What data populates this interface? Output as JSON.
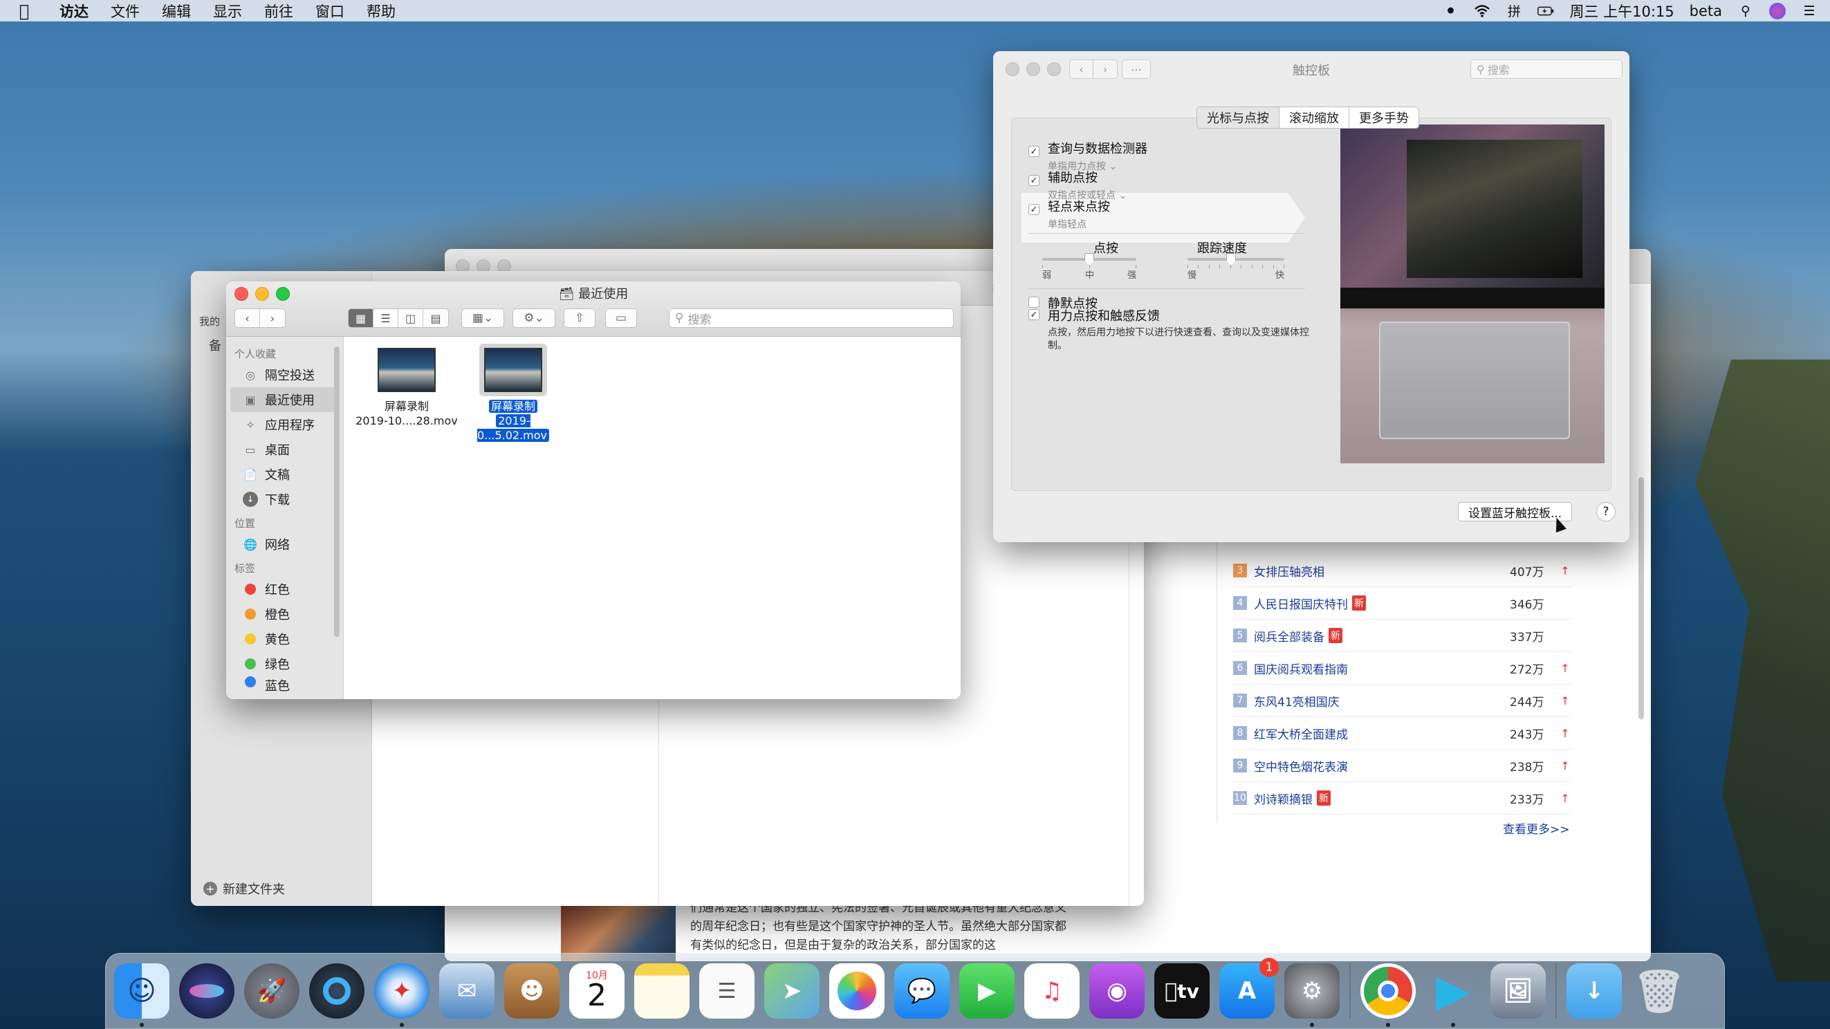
{
  "menubar": {
    "app_name": "访达",
    "items": [
      "文件",
      "编辑",
      "显示",
      "前往",
      "窗口",
      "帮助"
    ],
    "clock": "周三 上午10:15",
    "user": "beta"
  },
  "finder_back": {
    "sidebar_header_stub": "我的",
    "sidebar_item_stub": "备",
    "new_folder": "新建文件夹",
    "search_stub": "搜索"
  },
  "finder": {
    "title": "最近使用",
    "search_placeholder": "搜索",
    "sections": {
      "favorites": "个人收藏",
      "locations": "位置",
      "tags": "标签"
    },
    "favorites": [
      {
        "label": "隔空投送",
        "icon": "airdrop-icon"
      },
      {
        "label": "最近使用",
        "icon": "recents-icon"
      },
      {
        "label": "应用程序",
        "icon": "applications-icon"
      },
      {
        "label": "桌面",
        "icon": "desktop-icon"
      },
      {
        "label": "文稿",
        "icon": "documents-icon"
      },
      {
        "label": "下载",
        "icon": "downloads-icon"
      }
    ],
    "locations": [
      {
        "label": "网络",
        "icon": "network-icon"
      }
    ],
    "tags": [
      {
        "label": "红色",
        "color": "#f0443a"
      },
      {
        "label": "橙色",
        "color": "#f39a2c"
      },
      {
        "label": "黄色",
        "color": "#f5c82f"
      },
      {
        "label": "绿色",
        "color": "#4cbc4a"
      },
      {
        "label": "蓝色",
        "color": "#2c7ef5"
      }
    ],
    "files": [
      {
        "line1": "屏幕录制",
        "line2": "2019-10....28.mov"
      },
      {
        "line1": "屏幕录制",
        "line2": "2019-0...5.02.mov"
      }
    ]
  },
  "trackpad": {
    "title": "触控板",
    "search_placeholder": "搜索",
    "tabs": [
      "光标与点按",
      "滚动缩放",
      "更多手势"
    ],
    "options": [
      {
        "title": "查询与数据检测器",
        "subtitle": "单指用力点按 ⌄",
        "checked": true
      },
      {
        "title": "辅助点按",
        "subtitle": "双指点按或轻点 ⌄",
        "checked": true
      },
      {
        "title": "轻点来点按",
        "subtitle": "单指轻点",
        "checked": true
      }
    ],
    "click_slider": {
      "label": "点按",
      "min": "弱",
      "mid": "中",
      "max": "强",
      "value": 0.5
    },
    "tracking_slider": {
      "label": "跟踪速度",
      "min": "慢",
      "max": "快",
      "value": 0.45
    },
    "silent_click": {
      "label": "静默点按",
      "checked": false
    },
    "force_click": {
      "label": "用力点按和触感反馈",
      "checked": true,
      "description": "点按，然后用力地按下以进行快速查看、查询以及变速媒体控制。"
    },
    "bluetooth_button": "设置蓝牙触控板...",
    "help": "?"
  },
  "browser": {
    "article_text": "们通常是这个国家的独立、宪法的签署、元首诞辰或其他有重大纪念意义的周年纪念日；也有些是这个国家守护神的圣人节。虽然绝大部分国家都有类似的纪念日，但是由于复杂的政治关系，部分国家的这",
    "hot_list": [
      {
        "rank": "3",
        "title": "女排压轴亮相",
        "count": "407万",
        "new": false,
        "up": true
      },
      {
        "rank": "4",
        "title": "人民日报国庆特刊",
        "count": "346万",
        "new": true,
        "up": false
      },
      {
        "rank": "5",
        "title": "阅兵全部装备",
        "count": "337万",
        "new": true,
        "up": false
      },
      {
        "rank": "6",
        "title": "国庆阅兵观看指南",
        "count": "272万",
        "new": false,
        "up": true
      },
      {
        "rank": "7",
        "title": "东风41亮相国庆",
        "count": "244万",
        "new": false,
        "up": true
      },
      {
        "rank": "8",
        "title": "红军大桥全面建成",
        "count": "243万",
        "new": false,
        "up": true
      },
      {
        "rank": "9",
        "title": "空中特色烟花表演",
        "count": "238万",
        "new": false,
        "up": true
      },
      {
        "rank": "10",
        "title": "刘诗颖摘银",
        "count": "233万",
        "new": true,
        "up": true
      }
    ],
    "new_badge": "新",
    "up_arrow": "↑",
    "more_link": "查看更多>>"
  },
  "dock": {
    "calendar_month": "10月",
    "calendar_day": "2",
    "appstore_badge": "1",
    "tv_label": "tv",
    "apps": [
      {
        "icon": "finder-icon",
        "color": "#2f8bea",
        "running": true
      },
      {
        "icon": "siri-icon",
        "color": "#20203a",
        "running": false
      },
      {
        "icon": "launchpad-icon",
        "color": "#6f7580",
        "running": false
      },
      {
        "icon": "quicktime-icon",
        "color": "#26313d",
        "running": false
      },
      {
        "icon": "safari-icon",
        "color": "#2e8be6",
        "running": true
      },
      {
        "icon": "mail-icon",
        "color": "#3d6fb3",
        "running": false
      },
      {
        "icon": "contacts-icon",
        "color": "#a8763e",
        "running": false
      },
      {
        "icon": "calendar-icon",
        "color": "#ffffff",
        "running": false
      },
      {
        "icon": "notes-icon",
        "color": "#f7d44d",
        "running": false
      },
      {
        "icon": "reminders-icon",
        "color": "#f5f5f5",
        "running": false
      },
      {
        "icon": "maps-icon",
        "color": "#6fbf6a",
        "running": false
      },
      {
        "icon": "photos-icon",
        "color": "#f2f2f2",
        "running": false
      },
      {
        "icon": "messages-icon",
        "color": "#2f9df2",
        "running": false
      },
      {
        "icon": "facetime-icon",
        "color": "#35c04a",
        "running": false
      },
      {
        "icon": "music-icon",
        "color": "#f0f0f0",
        "running": false
      },
      {
        "icon": "podcasts-icon",
        "color": "#9a3fd6",
        "running": false
      },
      {
        "icon": "tv-icon",
        "color": "#111111",
        "running": false
      },
      {
        "icon": "appstore-icon",
        "color": "#1f8ef0",
        "running": false
      },
      {
        "icon": "system-preferences-icon",
        "color": "#6c6f76",
        "running": true
      },
      {
        "icon": "chrome-icon",
        "color": "#f3f3f3",
        "running": true
      },
      {
        "icon": "video-player-icon",
        "color": "#2cb8e8",
        "running": true
      },
      {
        "icon": "preview-icon",
        "color": "#8a95a6",
        "running": false
      },
      {
        "icon": "downloads-folder-icon",
        "color": "#5fb4f3",
        "running": false
      },
      {
        "icon": "trash-icon",
        "color": "#d6dbe0",
        "running": false
      }
    ]
  }
}
